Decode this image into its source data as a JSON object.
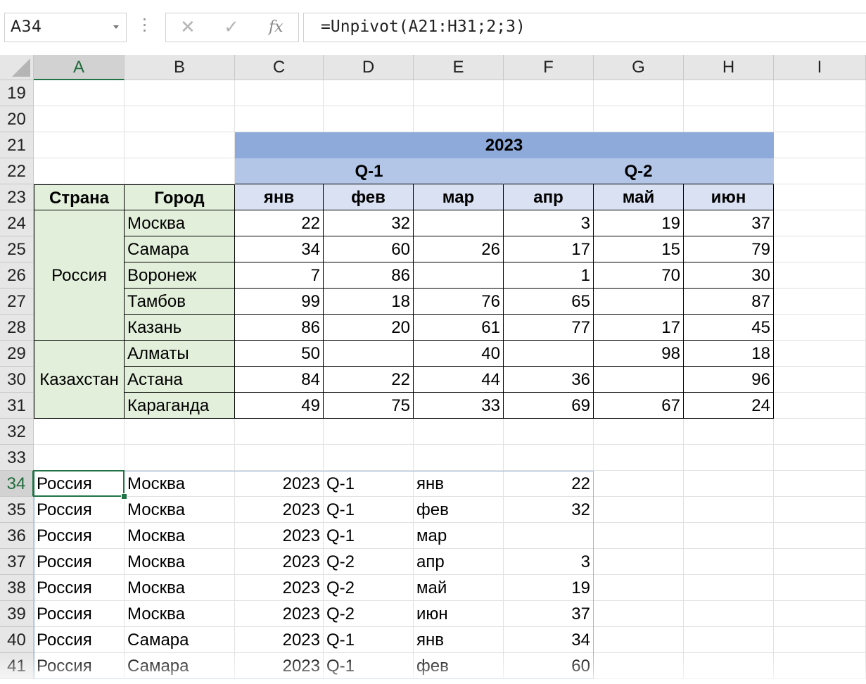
{
  "formula_bar": {
    "name_box": "A34",
    "cancel_icon": "✕",
    "enter_icon": "✓",
    "fx_icon": "fx",
    "formula": "=Unpivot(A21:H31;2;3)"
  },
  "columns": [
    "A",
    "B",
    "C",
    "D",
    "E",
    "F",
    "G",
    "H",
    "I"
  ],
  "selected_column": "A",
  "rows": [
    19,
    20,
    21,
    22,
    23,
    24,
    25,
    26,
    27,
    28,
    29,
    30,
    31,
    32,
    33,
    34,
    35,
    36,
    37,
    38,
    39,
    40,
    41
  ],
  "selected_row": 34,
  "source_table": {
    "year": "2023",
    "quarters": [
      "Q-1",
      "Q-2"
    ],
    "country_header": "Страна",
    "city_header": "Город",
    "months": [
      "янв",
      "фев",
      "мар",
      "апр",
      "май",
      "июн"
    ],
    "groups": [
      {
        "country": "Россия",
        "cities": [
          {
            "city": "Москва",
            "values": [
              "22",
              "32",
              "",
              "3",
              "19",
              "37"
            ]
          },
          {
            "city": "Самара",
            "values": [
              "34",
              "60",
              "26",
              "17",
              "15",
              "79"
            ]
          },
          {
            "city": "Воронеж",
            "values": [
              "7",
              "86",
              "",
              "1",
              "70",
              "30"
            ]
          },
          {
            "city": "Тамбов",
            "values": [
              "99",
              "18",
              "76",
              "65",
              "",
              "87"
            ]
          },
          {
            "city": "Казань",
            "values": [
              "86",
              "20",
              "61",
              "77",
              "17",
              "45"
            ]
          }
        ]
      },
      {
        "country": "Казахстан",
        "cities": [
          {
            "city": "Алматы",
            "values": [
              "50",
              "",
              "40",
              "",
              "98",
              "18"
            ]
          },
          {
            "city": "Астана",
            "values": [
              "84",
              "22",
              "44",
              "36",
              "",
              "96"
            ]
          },
          {
            "city": "Караганда",
            "values": [
              "49",
              "75",
              "33",
              "69",
              "67",
              "24"
            ]
          }
        ]
      }
    ]
  },
  "result_rows": [
    [
      "Россия",
      "Москва",
      "2023",
      "Q-1",
      "янв",
      "22"
    ],
    [
      "Россия",
      "Москва",
      "2023",
      "Q-1",
      "фев",
      "32"
    ],
    [
      "Россия",
      "Москва",
      "2023",
      "Q-1",
      "мар",
      ""
    ],
    [
      "Россия",
      "Москва",
      "2023",
      "Q-2",
      "апр",
      "3"
    ],
    [
      "Россия",
      "Москва",
      "2023",
      "Q-2",
      "май",
      "19"
    ],
    [
      "Россия",
      "Москва",
      "2023",
      "Q-2",
      "июн",
      "37"
    ],
    [
      "Россия",
      "Самара",
      "2023",
      "Q-1",
      "янв",
      "34"
    ],
    [
      "Россия",
      "Самара",
      "2023",
      "Q-1",
      "фев",
      "60"
    ]
  ]
}
